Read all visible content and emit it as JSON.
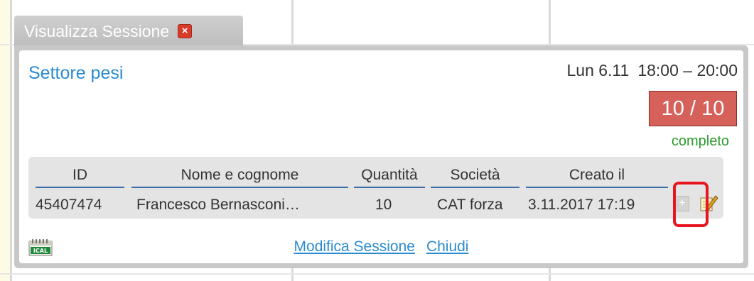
{
  "dialog": {
    "tab_title": "Visualizza Sessione",
    "close_icon": "close-x-icon",
    "session_name": "Settore pesi",
    "day": "Lun 6.11",
    "time": "18:00 – 20:00",
    "capacity": "10 / 10",
    "status": "completo",
    "colors": {
      "title": "#2a8bd0",
      "capacity_bg": "#d6605a",
      "status": "#2a9a2a",
      "highlight": "#e8151f"
    }
  },
  "table": {
    "headers": [
      "ID",
      "Nome e cognome",
      "Quantità",
      "Società",
      "Creato il"
    ],
    "rows": [
      {
        "id": "45407474",
        "name": "Francesco Bernasconi…",
        "quantity": "10",
        "company": "CAT forza",
        "created": "3.11.2017 17:19",
        "add_icon": "+",
        "edit_icon": "pencil-notepad-icon"
      }
    ]
  },
  "footer": {
    "ical_label": "ICAL",
    "edit_link": "Modifica Sessione",
    "close_link": "Chiudi"
  }
}
